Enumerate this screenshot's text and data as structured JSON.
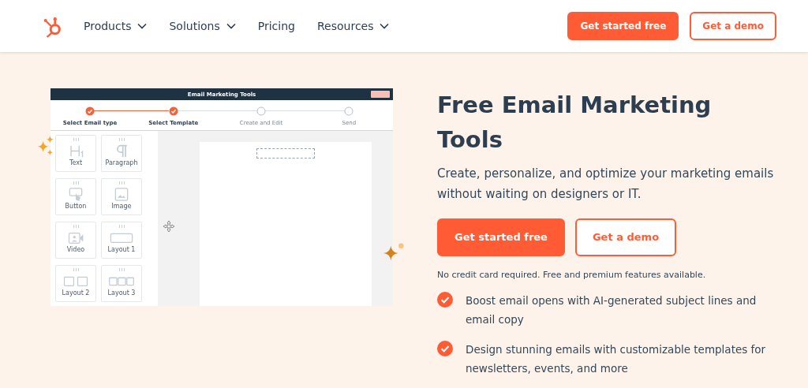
{
  "nav": {
    "items": [
      {
        "label": "Products",
        "dropdown": true
      },
      {
        "label": "Solutions",
        "dropdown": true
      },
      {
        "label": "Pricing",
        "dropdown": false
      },
      {
        "label": "Resources",
        "dropdown": true
      }
    ],
    "primary_button": "Get started free",
    "secondary_button": "Get a demo"
  },
  "mockup": {
    "title": "Email Marketing Tools",
    "steps": [
      {
        "label": "Select Email type",
        "done": true
      },
      {
        "label": "Select Template",
        "done": true
      },
      {
        "label": "Create and Edit",
        "done": false
      },
      {
        "label": "Send",
        "done": false
      }
    ],
    "blocks": [
      {
        "label": "Text",
        "kind": "heading"
      },
      {
        "label": "Paragraph",
        "kind": "paragraph"
      },
      {
        "label": "Button",
        "kind": "button"
      },
      {
        "label": "Image",
        "kind": "image"
      },
      {
        "label": "Video",
        "kind": "video"
      },
      {
        "label": "Layout 1",
        "kind": "layout1"
      },
      {
        "label": "Layout 2",
        "kind": "layout2"
      },
      {
        "label": "Layout 3",
        "kind": "layout3"
      }
    ]
  },
  "hero": {
    "title": "Free Email Marketing Tools",
    "subtitle": "Create, personalize, and optimize your marketing emails without waiting on designers or IT.",
    "primary_button": "Get started free",
    "secondary_button": "Get a demo",
    "note": "No credit card required. Free and premium features available.",
    "features": [
      "Boost email opens with AI-generated subject lines and email copy",
      "Design stunning emails with customizable templates for newsletters, events, and more"
    ]
  }
}
